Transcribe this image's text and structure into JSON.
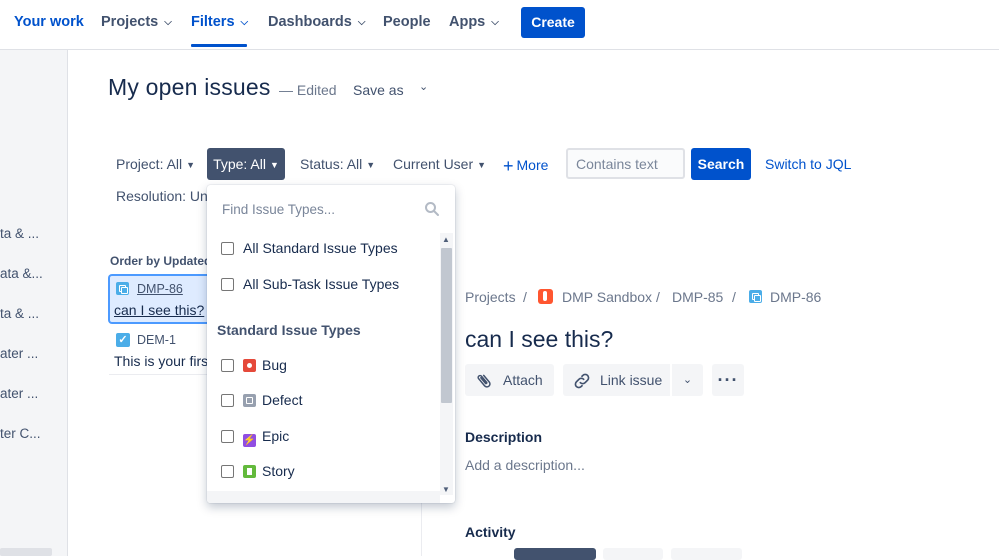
{
  "nav": {
    "your_work": "Your work",
    "projects": "Projects",
    "filters": "Filters",
    "dashboards": "Dashboards",
    "people": "People",
    "apps": "Apps",
    "create": "Create"
  },
  "sidebar": {
    "items": [
      "ta & ...",
      "ata &...",
      "ta & ...",
      "ater ...",
      "ater ...",
      "ter C..."
    ]
  },
  "header": {
    "title": "My open issues",
    "edited": "— Edited",
    "save_as": "Save as"
  },
  "filters": {
    "project": "Project: All",
    "type": "Type: All",
    "status": "Status: All",
    "current_user": "Current User",
    "more": "More",
    "text_placeholder": "Contains text",
    "search": "Search",
    "switch_jql": "Switch to JQL",
    "resolution": "Resolution: Unr"
  },
  "list": {
    "order_by": "Order by Updated",
    "issues": [
      {
        "key": "DMP-86",
        "summary": "can I see this?"
      },
      {
        "key": "DEM-1",
        "summary": "This is your first"
      }
    ]
  },
  "dropdown": {
    "search_placeholder": "Find Issue Types...",
    "options_top": [
      "All Standard Issue Types",
      "All Sub-Task Issue Types"
    ],
    "group_label": "Standard Issue Types",
    "types": [
      "Bug",
      "Defect",
      "Epic",
      "Story"
    ]
  },
  "detail": {
    "breadcrumb": {
      "projects": "Projects",
      "project_name": "DMP Sandbox",
      "parent": "DMP-85",
      "current": "DMP-86",
      "sep": "/"
    },
    "title": "can I see this?",
    "attach": "Attach",
    "link_issue": "Link issue",
    "description_heading": "Description",
    "description_placeholder": "Add a description...",
    "activity_heading": "Activity"
  },
  "colors": {
    "primary": "#0052CC",
    "nav_text": "#42526E",
    "dark_text": "#172B4D"
  }
}
